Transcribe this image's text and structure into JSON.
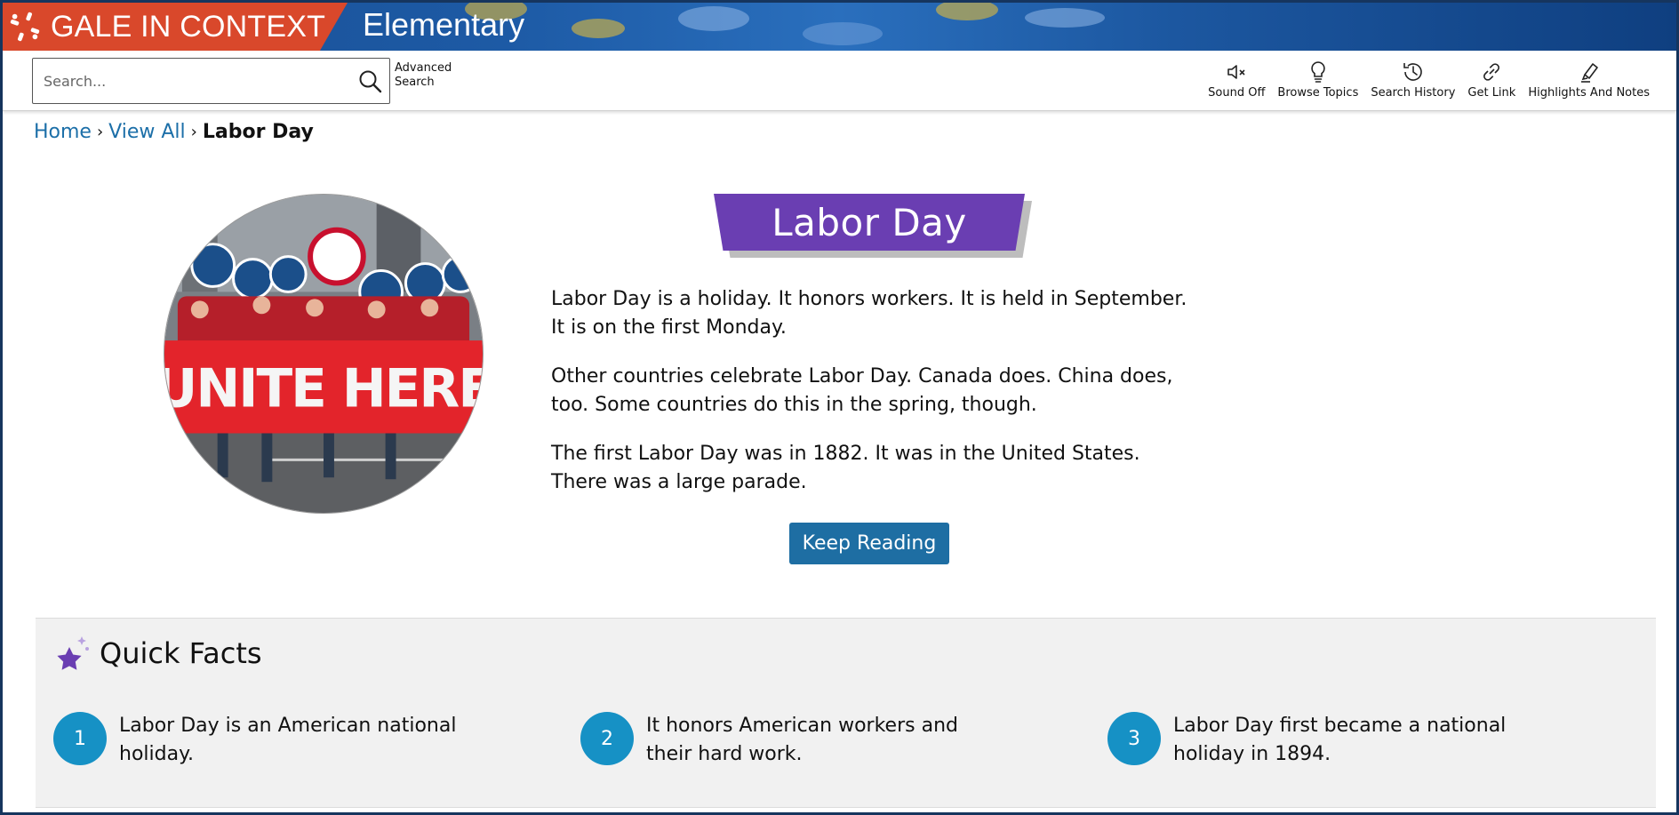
{
  "brand": {
    "name": "GALE IN CONTEXT",
    "product": "Elementary",
    "colors": {
      "brand_red": "#d9482b",
      "header_blue": "#1d5aa5"
    }
  },
  "toolbar": {
    "search_placeholder": "Search...",
    "advanced_search": "Advanced Search",
    "tools": [
      {
        "label": "Sound Off",
        "icon": "sound-off-icon"
      },
      {
        "label": "Browse Topics",
        "icon": "lightbulb-icon"
      },
      {
        "label": "Search History",
        "icon": "history-icon"
      },
      {
        "label": "Get Link",
        "icon": "link-icon"
      },
      {
        "label": "Highlights And Notes",
        "icon": "highlighter-icon"
      }
    ]
  },
  "breadcrumb": {
    "home": "Home",
    "view_all": "View All",
    "current": "Labor Day",
    "separator": "›"
  },
  "article": {
    "title": "Labor Day",
    "paragraphs": [
      "Labor Day is a holiday. It honors workers. It is held in September. It is on the first Monday.",
      "Other countries celebrate Labor Day. Canada does. China does, too. Some countries do this in the spring, though.",
      "The first Labor Day was in 1882. It was in the United States. There was a large parade."
    ],
    "keep_reading": "Keep Reading",
    "image_banner_text": "UNITE HERE",
    "title_color": "#6a3eb2",
    "button_color": "#1e6ea3"
  },
  "quick_facts": {
    "heading": "Quick Facts",
    "facts": [
      {
        "number": "1",
        "text": "Labor Day is an American national holiday."
      },
      {
        "number": "2",
        "text": "It honors American workers and their hard work."
      },
      {
        "number": "3",
        "text": "Labor Day first became a national holiday in 1894."
      }
    ],
    "number_color": "#1691c5"
  }
}
